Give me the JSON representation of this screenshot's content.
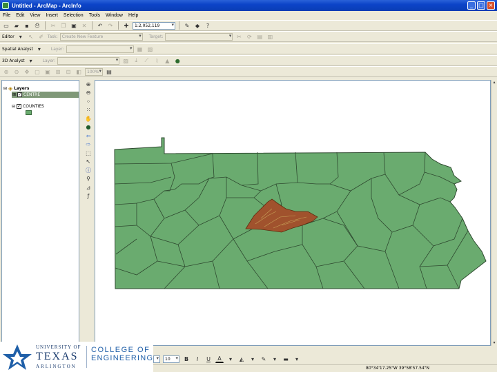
{
  "window": {
    "title": "Untitled - ArcMap - ArcInfo"
  },
  "menu": [
    "File",
    "Edit",
    "View",
    "Insert",
    "Selection",
    "Tools",
    "Window",
    "Help"
  ],
  "standard_toolbar": {
    "scale": "1:2,052,119"
  },
  "editor_toolbar": {
    "editor_label": "Editor",
    "task_label": "Task:",
    "task_value": "Create New Feature",
    "target_label": "Target:"
  },
  "spatial_analyst": {
    "label": "Spatial Analyst",
    "layer_label": "Layer:"
  },
  "analyst_3d": {
    "label": "3D Analyst",
    "layer_label": "Layer:"
  },
  "layout_toolbar": {
    "zoom_value": "100%"
  },
  "toc": {
    "data_frame": "Layers",
    "layers": [
      {
        "name": "CENTRE",
        "checked": true,
        "selected": true
      },
      {
        "name": "COUNTIES",
        "checked": true,
        "selected": false
      }
    ]
  },
  "draw_toolbar": {
    "font_size": "10",
    "bold": "B",
    "italic": "I",
    "underline": "U",
    "font_color": "A"
  },
  "status": {
    "coordinates": "80°34'17.25\"W  39°58'57.54\"N"
  },
  "logo": {
    "university_line": "UNIVERSITY OF",
    "texas": "TEXAS",
    "arlington": "ARLINGTON",
    "college_line1": "COLLEGE OF",
    "college_line2": "ENGINEERING"
  },
  "colors": {
    "county_fill": "#6aab6f",
    "county_stroke": "#2f4a30",
    "centre_fill": "#a0522d",
    "title_blue": "#0c44c8",
    "logo_blue": "#1f5fa8"
  }
}
